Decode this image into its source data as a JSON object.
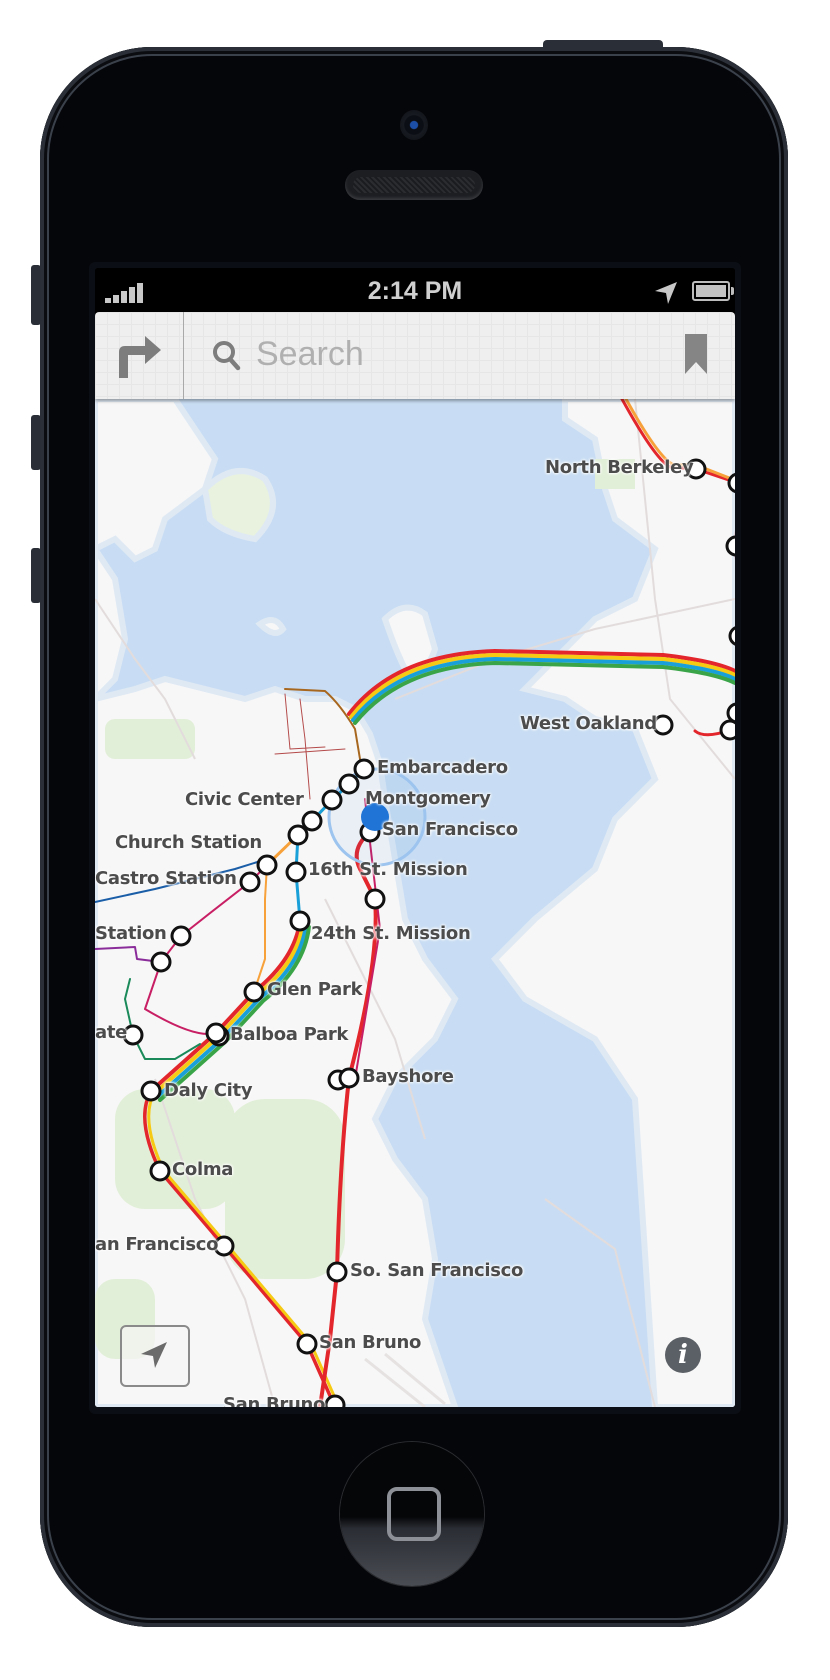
{
  "status_bar": {
    "time": "2:14 PM",
    "signal_bars": 5,
    "location_services": true,
    "battery_level": 1.0
  },
  "navbar": {
    "directions_icon": "turn-right-arrow-icon",
    "search_placeholder": "Search",
    "search_value": "",
    "bookmark_icon": "bookmark-icon"
  },
  "map": {
    "stations": [
      {
        "label": "North Berkeley"
      },
      {
        "label": "West Oakland"
      },
      {
        "label": "Embarcadero"
      },
      {
        "label": "Montgomery"
      },
      {
        "label": "San Francisco"
      },
      {
        "label": "Civic Center"
      },
      {
        "label": "Church Station"
      },
      {
        "label": "Castro Station"
      },
      {
        "label": "16th St. Mission"
      },
      {
        "label": "24th St. Mission"
      },
      {
        "label": "Station"
      },
      {
        "label": "Glen Park"
      },
      {
        "label": "Balboa Park"
      },
      {
        "label": "ate"
      },
      {
        "label": "Bayshore"
      },
      {
        "label": "Daly City"
      },
      {
        "label": "Colma"
      },
      {
        "label": "an Francisco"
      },
      {
        "label": "So. San Francisco"
      },
      {
        "label": "San Bruno"
      },
      {
        "label": "San Bruno"
      }
    ],
    "line_colors": {
      "red": "#e3262c",
      "orange": "#f7a13b",
      "yellow": "#f6c913",
      "blue": "#1aa0d9",
      "green": "#3aa548",
      "magenta": "#c81f64",
      "brown": "#a8671f",
      "dark_blue": "#1b5ea8",
      "purple": "#8a2c9a",
      "teal": "#1b8a5a"
    },
    "water_color": "#c8ddf3",
    "land_color": "#f7f7f7",
    "park_color": "#e2efd8",
    "user_location_color": "#1f74d6"
  },
  "controls": {
    "locate_icon": "location-arrow-icon",
    "info_label": "i"
  }
}
